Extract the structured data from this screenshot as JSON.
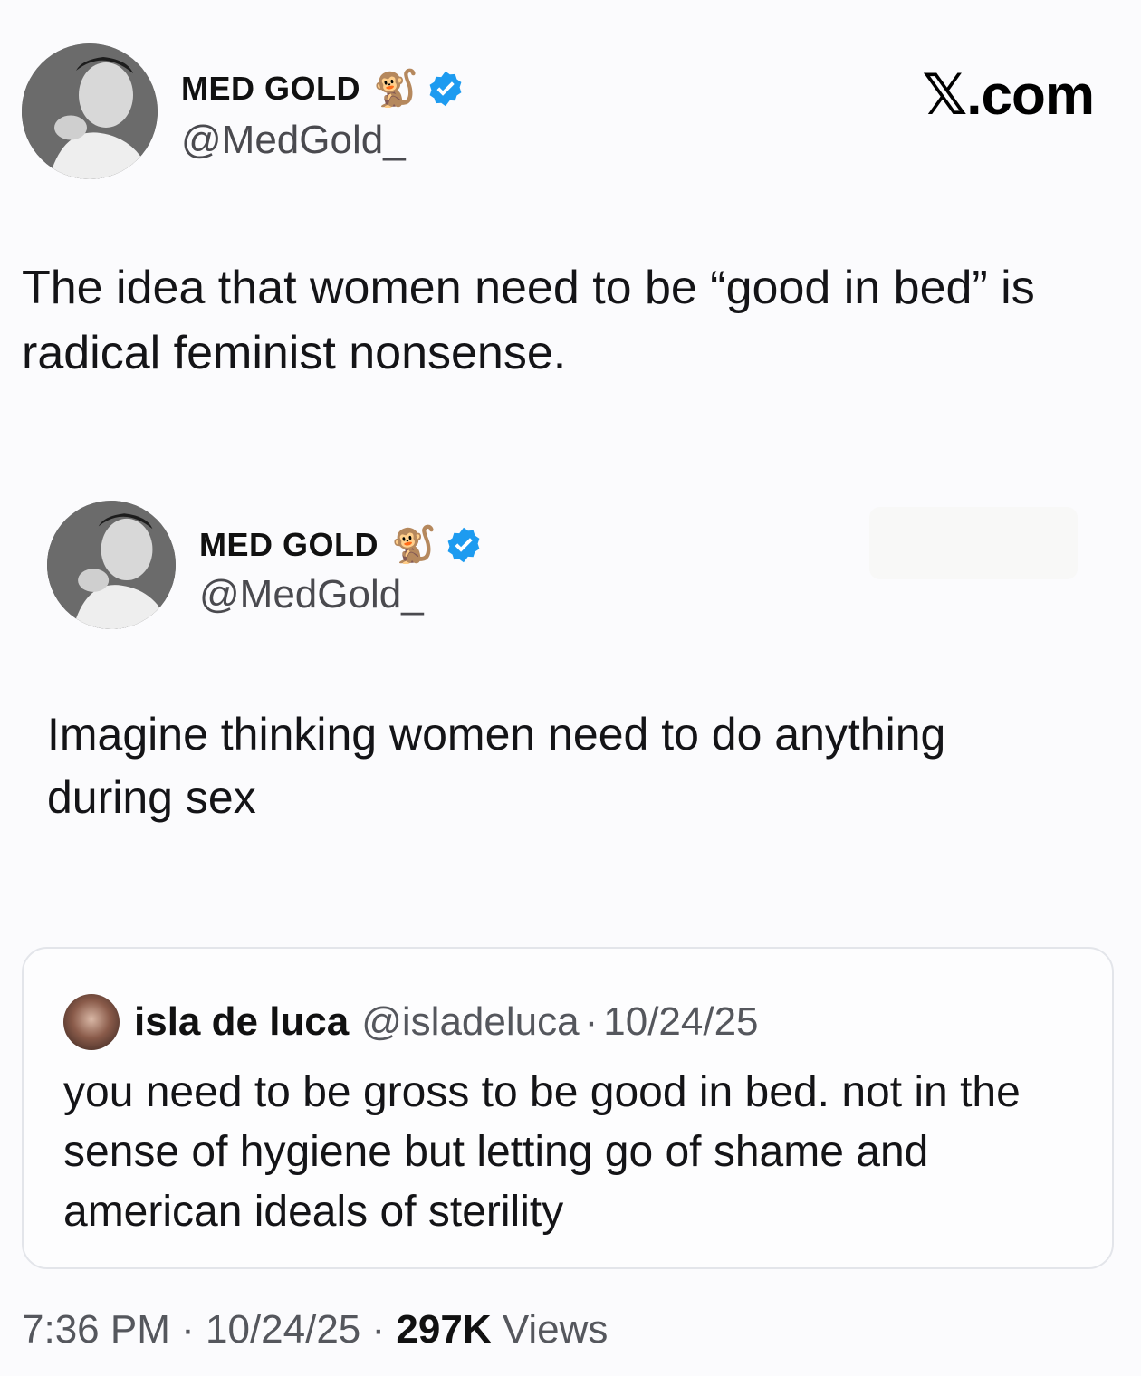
{
  "brand": {
    "label": "𝕏.com"
  },
  "main_tweet": {
    "author_name": "MED GOLD",
    "author_handle": "@MedGold_",
    "name_emoji": "🐒",
    "text": "The idea that women need to be “good in bed” is radical feminist nonsense."
  },
  "inner_tweet": {
    "author_name": "MED GOLD",
    "author_handle": "@MedGold_",
    "name_emoji": "🐒",
    "text": "Imagine thinking women need to do anything during sex"
  },
  "quoted_tweet": {
    "author_name": "isla de luca",
    "author_handle": "@isladeluca",
    "separator": "·",
    "date": "10/24/25",
    "text": "you need to be gross to be good in bed. not in the sense of hygiene but letting go of shame and american ideals of sterility"
  },
  "footer": {
    "time": "7:36 PM",
    "separator": "·",
    "date": "10/24/25",
    "views_count": "297K",
    "views_label": "Views"
  },
  "colors": {
    "verified": "#1d9bf0",
    "background": "#fbfbfd",
    "text": "#141417",
    "muted": "#55575d"
  },
  "icons": [
    "monkey-emoji-icon",
    "verified-badge-icon",
    "avatar-photo-icon"
  ]
}
